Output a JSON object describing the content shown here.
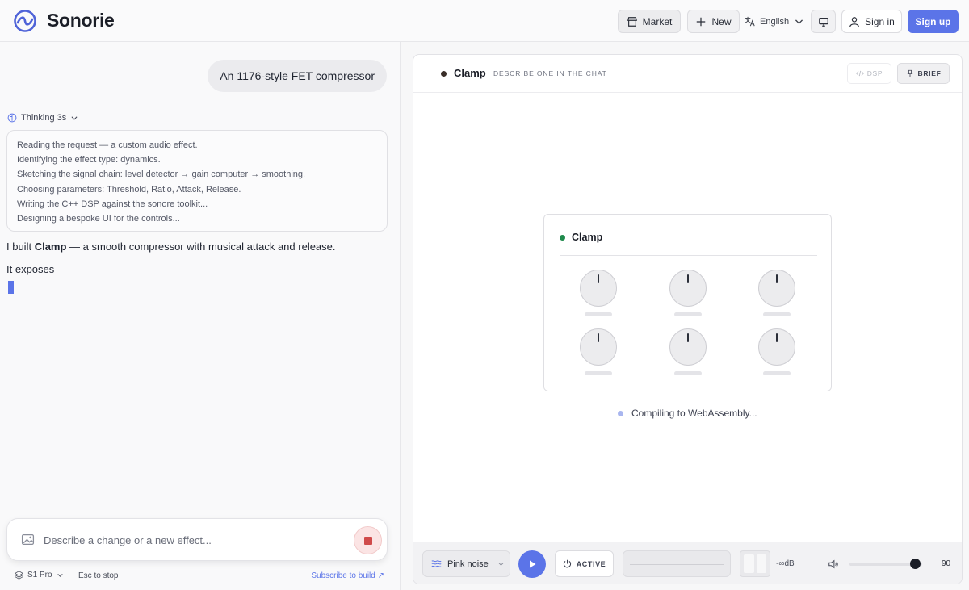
{
  "header": {
    "brand": "Sonorie",
    "market_label": "Market",
    "new_label": "New",
    "language": "English",
    "signin_label": "Sign in",
    "signup_label": "Sign up"
  },
  "chat": {
    "user_message": "An 1176-style FET compressor",
    "thinking_label": "Thinking 3s",
    "thinking_steps": [
      "Reading the request — a custom audio effect.",
      "Identifying the effect type: dynamics.",
      "Sketching the signal chain: level detector → gain computer → smoothing.",
      "Choosing parameters: Threshold, Ratio, Attack, Release.",
      "Writing the C++ DSP against the sonore toolkit...",
      "Designing a bespoke UI for the controls..."
    ],
    "reply_prefix": "I built ",
    "reply_name": "Clamp",
    "reply_suffix": " — a smooth compressor with musical attack and release.",
    "reply_line2": "It exposes",
    "input_placeholder": "Describe a change or a new effect...",
    "model": "S1 Pro",
    "esc_hint": "Esc  to stop",
    "subscribe": "Subscribe to build ↗"
  },
  "preview": {
    "plugin_name": "Clamp",
    "subtitle": "Describe one in the chat",
    "dsp_label": "DSP",
    "brief_label": "BRIEF",
    "card_title": "Clamp",
    "status": "Compiling to WebAssembly...",
    "accent_color": "#5b74e8",
    "status_dot_color": "#1f8a4c"
  },
  "transport": {
    "source": "Pink noise",
    "active_label": "ACTIVE",
    "db_readout": "-∞dB",
    "volume": "90",
    "volume_level": 0.9
  }
}
